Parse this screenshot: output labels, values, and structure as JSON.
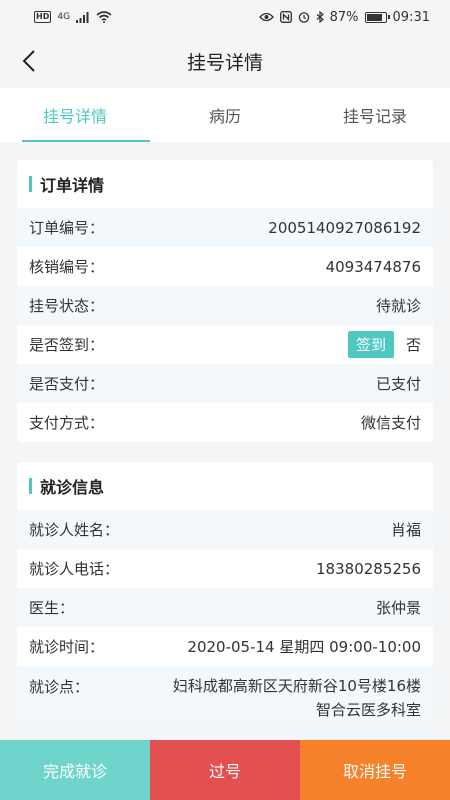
{
  "status_bar": {
    "hd": "HD",
    "network": "4G",
    "battery": "87%",
    "battery_level": 0.87,
    "time": "09:31"
  },
  "header": {
    "title": "挂号详情"
  },
  "tabs": [
    {
      "label": "挂号详情",
      "active": true
    },
    {
      "label": "病历",
      "active": false
    },
    {
      "label": "挂号记录",
      "active": false
    }
  ],
  "order_card": {
    "title": "订单详情",
    "rows": [
      {
        "label": "订单编号：",
        "value": "2005140927086192"
      },
      {
        "label": "核销编号：",
        "value": "4093474876"
      },
      {
        "label": "挂号状态：",
        "value": "待就诊"
      },
      {
        "label": "是否签到：",
        "button": "签到",
        "value": "否"
      },
      {
        "label": "是否支付：",
        "value": "已支付"
      },
      {
        "label": "支付方式：",
        "value": "微信支付"
      }
    ]
  },
  "visit_card": {
    "title": "就诊信息",
    "rows": [
      {
        "label": "就诊人姓名：",
        "value": "肖福"
      },
      {
        "label": "就诊人电话：",
        "value": "18380285256"
      },
      {
        "label": "医生：",
        "value": "张仲景"
      },
      {
        "label": "就诊时间：",
        "value": "2020-05-14 星期四 09:00-10:00"
      },
      {
        "label": "就诊点：",
        "value": "妇科成都高新区天府新谷10号楼16楼智合云医多科室"
      }
    ]
  },
  "bottom_bar": {
    "complete": "完成就诊",
    "pass": "过号",
    "cancel": "取消挂号"
  },
  "colors": {
    "accent": "#4ec8c0",
    "complete": "#6fd4cb",
    "pass": "#e2514f",
    "cancel": "#f5822a"
  }
}
